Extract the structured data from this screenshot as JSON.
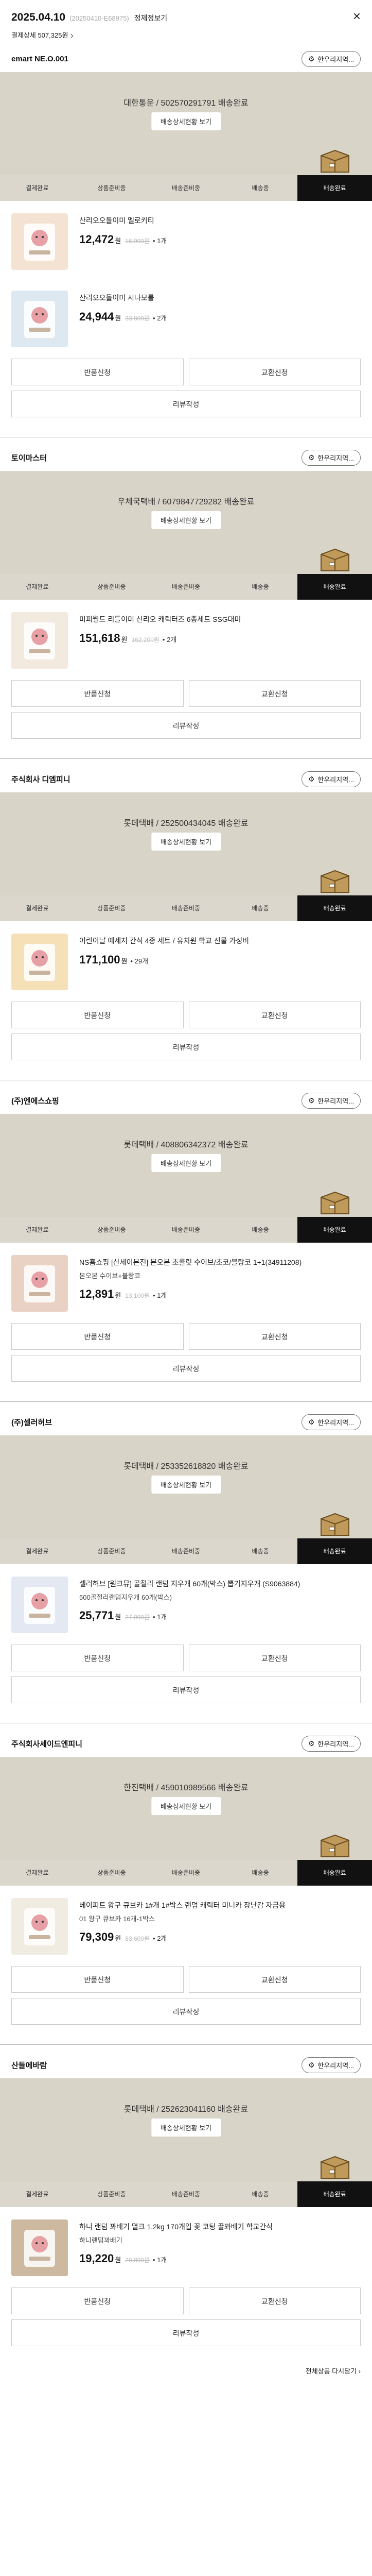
{
  "header": {
    "date": "2025.04.10",
    "order_no": "(20250410-E68975)",
    "detail_link": "정제정보기",
    "close_icon": "close-icon",
    "payment_label": "결제상세 507,325원"
  },
  "contact_label": "한우리지역...",
  "delivery_button": "배송상세현황 보기",
  "stages": [
    "결제완료",
    "상품준비중",
    "배송준비중",
    "배송중",
    "배송완료"
  ],
  "actions": {
    "return": "반품신청",
    "exchange": "교환신청",
    "review": "리뷰작성"
  },
  "sellers": [
    {
      "name": "emart NE.O.001",
      "delivery": "대한통운 / 502570291791 배송완료",
      "items": [
        {
          "title": "산리오오돌이미 멜로키티",
          "price": "12,472",
          "orig": "16,900원",
          "qty": "1개",
          "option": "",
          "thumb_color": "#f4e3d3"
        },
        {
          "title": "산리오오돌이미 시나모롤",
          "price": "24,944",
          "orig": "33,800원",
          "qty": "2개",
          "option": "",
          "thumb_color": "#dde8f0"
        }
      ]
    },
    {
      "name": "토이마스터",
      "delivery": "우체국택배 / 6079847729282 배송완료",
      "items": [
        {
          "title": "미피월드 리틀이미 산리오 캐릭터즈 6종세트 SSG대미",
          "price": "151,618",
          "orig": "162,200원",
          "qty": "2개",
          "option": "",
          "thumb_color": "#f3eadf"
        }
      ]
    },
    {
      "name": "주식회사 디엠피니",
      "delivery": "롯데택배 / 252500434045 배송완료",
      "items": [
        {
          "title": "어린이날 예세지 간식 4종 세트 / 유치원 학교 선물 가성비",
          "price": "171,100",
          "orig": "",
          "qty": "29개",
          "option": "",
          "thumb_color": "#f6e0b8"
        }
      ]
    },
    {
      "name": "(주)엔에스쇼핑",
      "delivery": "롯데택배 / 408806342372 배송완료",
      "items": [
        {
          "title": "NS홈쇼핑 [산세이본진] 본오본 초콜릿 수이브/초코/블랑코 1+1(34911208)",
          "price": "12,891",
          "orig": "13,100원",
          "qty": "1개",
          "option": "본오본 수이브+블랑코",
          "thumb_color": "#e9d2c4"
        }
      ]
    },
    {
      "name": "(주)셀러허브",
      "delivery": "롯데택배 / 253352618820 배송완료",
      "items": [
        {
          "title": "셀러허브 [원크뮤] 골절리 랜덤 지우개 60개(박스) 뽑기지우개 (S9063884)",
          "price": "25,771",
          "orig": "27,000원",
          "qty": "1개",
          "option": "500골절리랜덤지우개 60개(박스)",
          "thumb_color": "#e4e8f2"
        }
      ]
    },
    {
      "name": "주식회사세이드엔피니",
      "delivery": "한진택배 / 459010989566 배송완료",
      "items": [
        {
          "title": "베이피트 왕구 큐브카 1#개 1#박스 랜덤 캐릭터 미니카 장난감 자금용",
          "price": "79,309",
          "orig": "83,600원",
          "qty": "2개",
          "option": "01 왕구 큐브카 16개-1박스",
          "thumb_color": "#f1ece2"
        }
      ]
    },
    {
      "name": "산들에바람",
      "delivery": "롯데택배 / 252623041160 배송완료",
      "items": [
        {
          "title": "하니 랜덤 꽈배기 멸크 1.2kg 170개입 꽃 코팅 꿀꽈배기 학교간식",
          "price": "19,220",
          "orig": "20,890원",
          "qty": "1개",
          "option": "하니랜덤꽈배기",
          "thumb_color": "#cdb9a0"
        }
      ]
    }
  ],
  "footer_label": "전체상품 다시담기"
}
